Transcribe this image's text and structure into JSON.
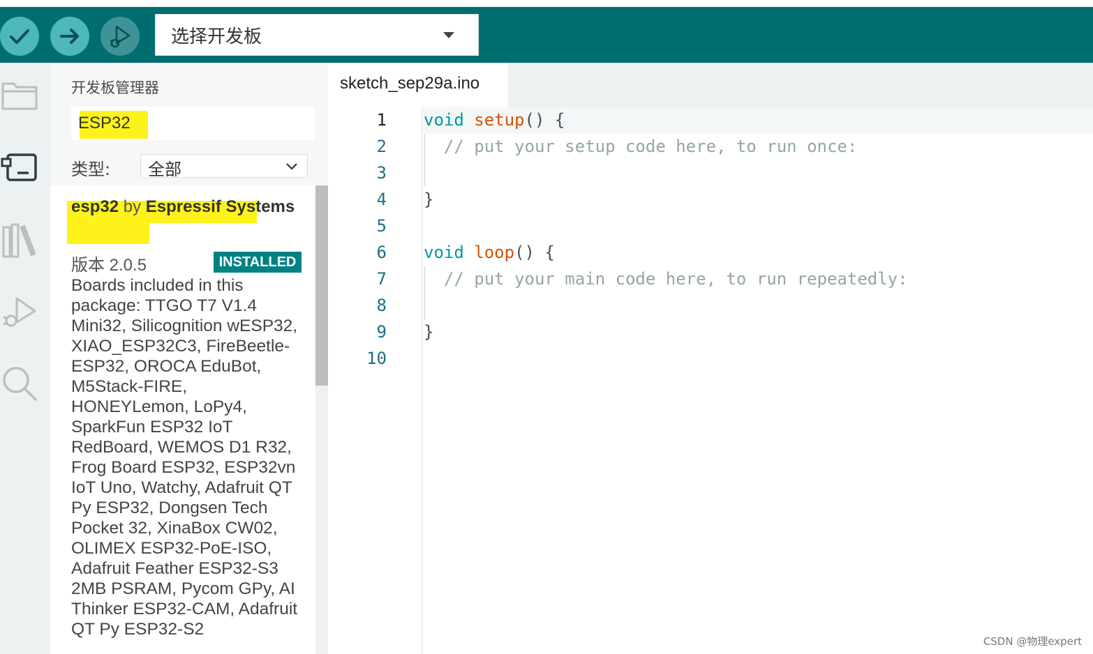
{
  "toolbar": {
    "verify_icon": "check-icon",
    "upload_icon": "arrow-right-icon",
    "debug_icon": "debug-icon",
    "board_select": {
      "label": "选择开发板"
    }
  },
  "activity_bar": {
    "items": [
      "folder-icon",
      "board-icon",
      "library-icon",
      "debug-icon",
      "search-icon"
    ]
  },
  "boards_manager": {
    "title": "开发板管理器",
    "search_value": "ESP32",
    "type_label": "类型:",
    "type_value": "全部",
    "result": {
      "name": "esp32",
      "by": "by",
      "author": "Espressif Systems",
      "version": "版本 2.0.5",
      "status_badge": "INSTALLED",
      "description": "Boards included in this package: TTGO T7 V1.4 Mini32, Silicognition wESP32, XIAO_ESP32C3, FireBeetle-ESP32, OROCA EduBot, M5Stack-FIRE, HONEYLemon, LoPy4, SparkFun ESP32 IoT RedBoard, WEMOS D1 R32, Frog Board ESP32, ESP32vn IoT Uno, Watchy, Adafruit QT Py ESP32, Dongsen Tech Pocket 32, XinaBox CW02, OLIMEX ESP32-PoE-ISO, Adafruit Feather ESP32-S3 2MB PSRAM, Pycom GPy, AI Thinker ESP32-CAM, Adafruit QT Py ESP32-S2"
    }
  },
  "editor": {
    "tab_name": "sketch_sep29a.ino",
    "line_numbers": [
      "1",
      "2",
      "3",
      "4",
      "5",
      "6",
      "7",
      "8",
      "9",
      "10"
    ],
    "code": {
      "l1_kw": "void",
      "l1_fn": "setup",
      "l1_rest": "() {",
      "l2": "  // put your setup code here, to run once:",
      "l4": "}",
      "l6_kw": "void",
      "l6_fn": "loop",
      "l6_rest": "() {",
      "l7": "  // put your main code here, to run repeatedly:",
      "l9": "}"
    }
  },
  "watermark": "CSDN @物理expert",
  "colors": {
    "toolbar": "#006d70",
    "toolbar_button": "#4db7bb",
    "badge": "#008184",
    "highlight": "#fdf31a",
    "keyword": "#00979d",
    "function": "#d35400",
    "comment": "#95a5a6"
  }
}
